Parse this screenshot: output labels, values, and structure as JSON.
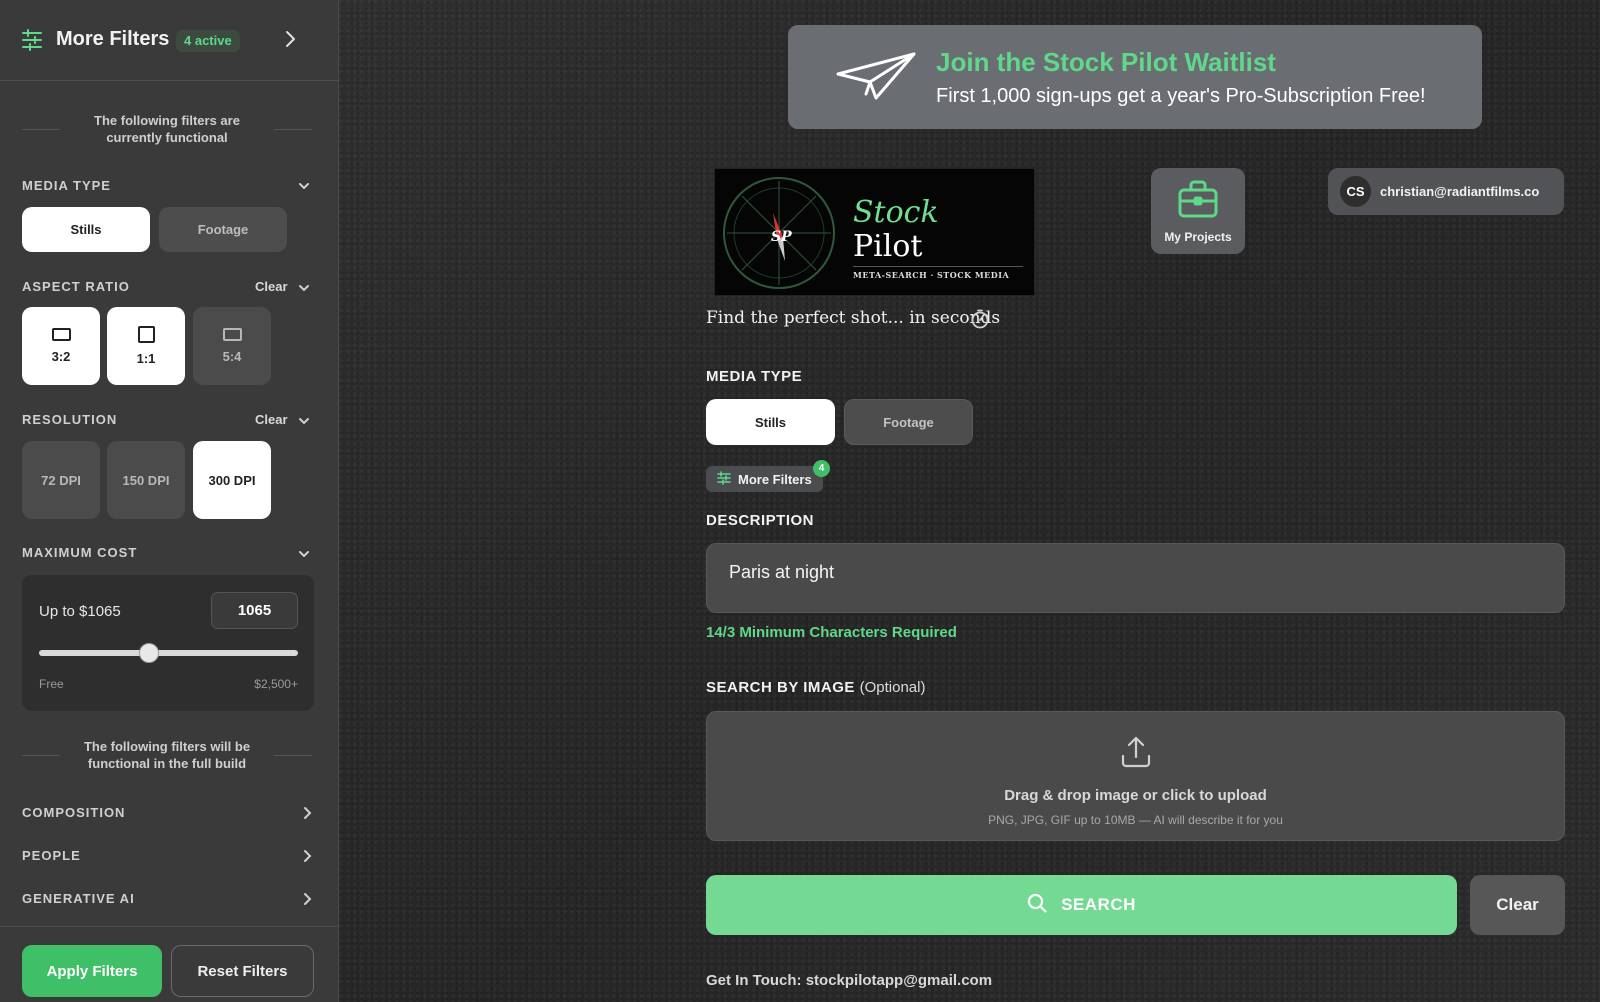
{
  "sidebar": {
    "title": "More Filters",
    "active_badge": "4 active",
    "note_functional": "The following filters are currently functional",
    "media_type": {
      "label": "MEDIA TYPE",
      "options": [
        "Stills",
        "Footage"
      ],
      "selected": "Stills"
    },
    "aspect_ratio": {
      "label": "ASPECT RATIO",
      "clear": "Clear",
      "options": [
        "3:2",
        "1:1",
        "5:4"
      ],
      "selected": [
        "3:2",
        "1:1"
      ]
    },
    "resolution": {
      "label": "RESOLUTION",
      "clear": "Clear",
      "options": [
        "72 DPI",
        "150 DPI",
        "300 DPI"
      ],
      "selected": "300 DPI"
    },
    "max_cost": {
      "label": "MAXIMUM COST",
      "summary": "Up to $1065",
      "value": "1065",
      "min_label": "Free",
      "max_label": "$2,500+",
      "slider_fraction": 0.426
    },
    "note_future": "The following filters will be functional in the full build",
    "collapsed_sections": [
      "COMPOSITION",
      "PEOPLE",
      "GENERATIVE AI"
    ],
    "apply_label": "Apply Filters",
    "reset_label": "Reset Filters"
  },
  "banner": {
    "title": "Join the Stock Pilot Waitlist",
    "subtitle": "First 1,000 sign-ups get a year's Pro-Subscription Free!"
  },
  "logo": {
    "word1": "Stock",
    "word2": "Pilot",
    "tagline": "META-SEARCH · STOCK MEDIA",
    "mark": "SP"
  },
  "tagline": "Find the perfect shot... in seconds",
  "header": {
    "projects_label": "My Projects",
    "user_initials": "CS",
    "user_email": "christian@radiantfilms.co"
  },
  "main": {
    "media_type_label": "MEDIA TYPE",
    "media_options": [
      "Stills",
      "Footage"
    ],
    "more_filters_label": "More Filters",
    "more_filters_count": "4",
    "description_label": "DESCRIPTION",
    "description_value": "Paris at night",
    "min_chars": "14/3 Minimum Characters Required",
    "image_label": "SEARCH BY IMAGE",
    "image_optional": "(Optional)",
    "upload_title": "Drag & drop image or click to upload",
    "upload_hint": "PNG, JPG, GIF up to 10MB — AI will describe it for you",
    "search_label": "SEARCH",
    "clear_label": "Clear",
    "contact": "Get In Touch: stockpilotapp@gmail.com"
  },
  "colors": {
    "accent": "#5fd88a",
    "search_button": "#74d993",
    "apply_button": "#3fbf68"
  },
  "icons": [
    "filter-icon",
    "chevron-right-icon",
    "chevron-down-icon",
    "paper-plane-icon",
    "briefcase-icon",
    "timer-icon",
    "upload-icon",
    "search-icon",
    "compass-icon"
  ]
}
